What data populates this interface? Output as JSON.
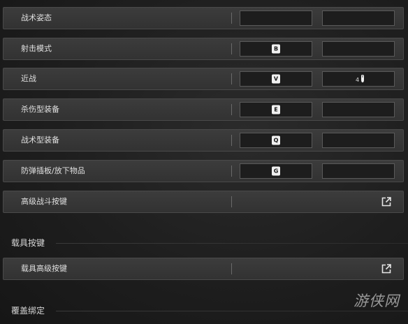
{
  "bindings": [
    {
      "label": "战术姿态",
      "primary_key": "",
      "secondary_key": ""
    },
    {
      "label": "射击模式",
      "primary_key": "B",
      "secondary_key": ""
    },
    {
      "label": "近战",
      "primary_key": "V",
      "secondary_key": "",
      "secondary_icon": "mouse-button-4-icon",
      "secondary_icon_text": "4"
    },
    {
      "label": "杀伤型装备",
      "primary_key": "E",
      "secondary_key": ""
    },
    {
      "label": "战术型装备",
      "primary_key": "Q",
      "secondary_key": ""
    },
    {
      "label": "防弹插板/放下物品",
      "primary_key": "G",
      "secondary_key": ""
    }
  ],
  "advanced_combat": {
    "label": "高级战斗按键",
    "icon": "external-link-icon"
  },
  "vehicle_section": {
    "title": "载具按键"
  },
  "vehicle_advanced": {
    "label": "载具高级按键",
    "icon": "external-link-icon"
  },
  "override_section": {
    "title": "覆盖绑定"
  },
  "watermark": {
    "text": "游侠网"
  },
  "colors": {
    "background": "#1e1e1e",
    "row": "#383838",
    "slot": "#1d1d1d",
    "keycap": "#f0f0f0"
  }
}
